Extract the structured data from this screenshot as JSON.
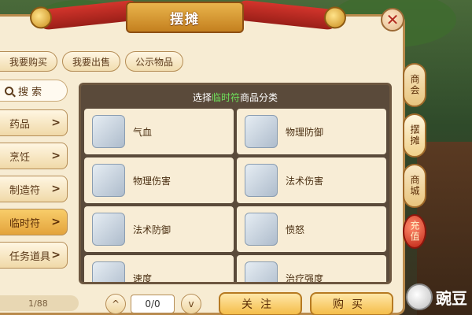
{
  "title": "摆摊",
  "close_symbol": "✕",
  "tabs": [
    {
      "label": "我要购买"
    },
    {
      "label": "我要出售"
    },
    {
      "label": "公示物品"
    }
  ],
  "sidebar": {
    "search_label": "搜 索",
    "categories": [
      {
        "label": "药品",
        "chevron": ">"
      },
      {
        "label": "烹饪",
        "chevron": ">"
      },
      {
        "label": "制造符",
        "chevron": ">"
      },
      {
        "label": "临时符",
        "chevron": ">",
        "active": true
      },
      {
        "label": "任务道具",
        "chevron": ">"
      }
    ]
  },
  "content": {
    "header_prefix": "选择",
    "header_highlight": "临时符",
    "header_suffix": "商品分类",
    "items": [
      {
        "label": "气血"
      },
      {
        "label": "物理防御"
      },
      {
        "label": "物理伤害"
      },
      {
        "label": "法术伤害"
      },
      {
        "label": "法术防御"
      },
      {
        "label": "愤怒"
      },
      {
        "label": "速度"
      },
      {
        "label": "治疗强度"
      }
    ]
  },
  "bottom": {
    "progress_text": "1/88",
    "page_prev": "^",
    "page_next": "v",
    "page_value": "0/0",
    "follow_label": "关注",
    "buy_label": "购买"
  },
  "side_tabs": [
    {
      "label": "商会"
    },
    {
      "label": "摆摊",
      "active": true
    },
    {
      "label": "商城"
    },
    {
      "label": "充值"
    }
  ],
  "watermark": "豌豆"
}
